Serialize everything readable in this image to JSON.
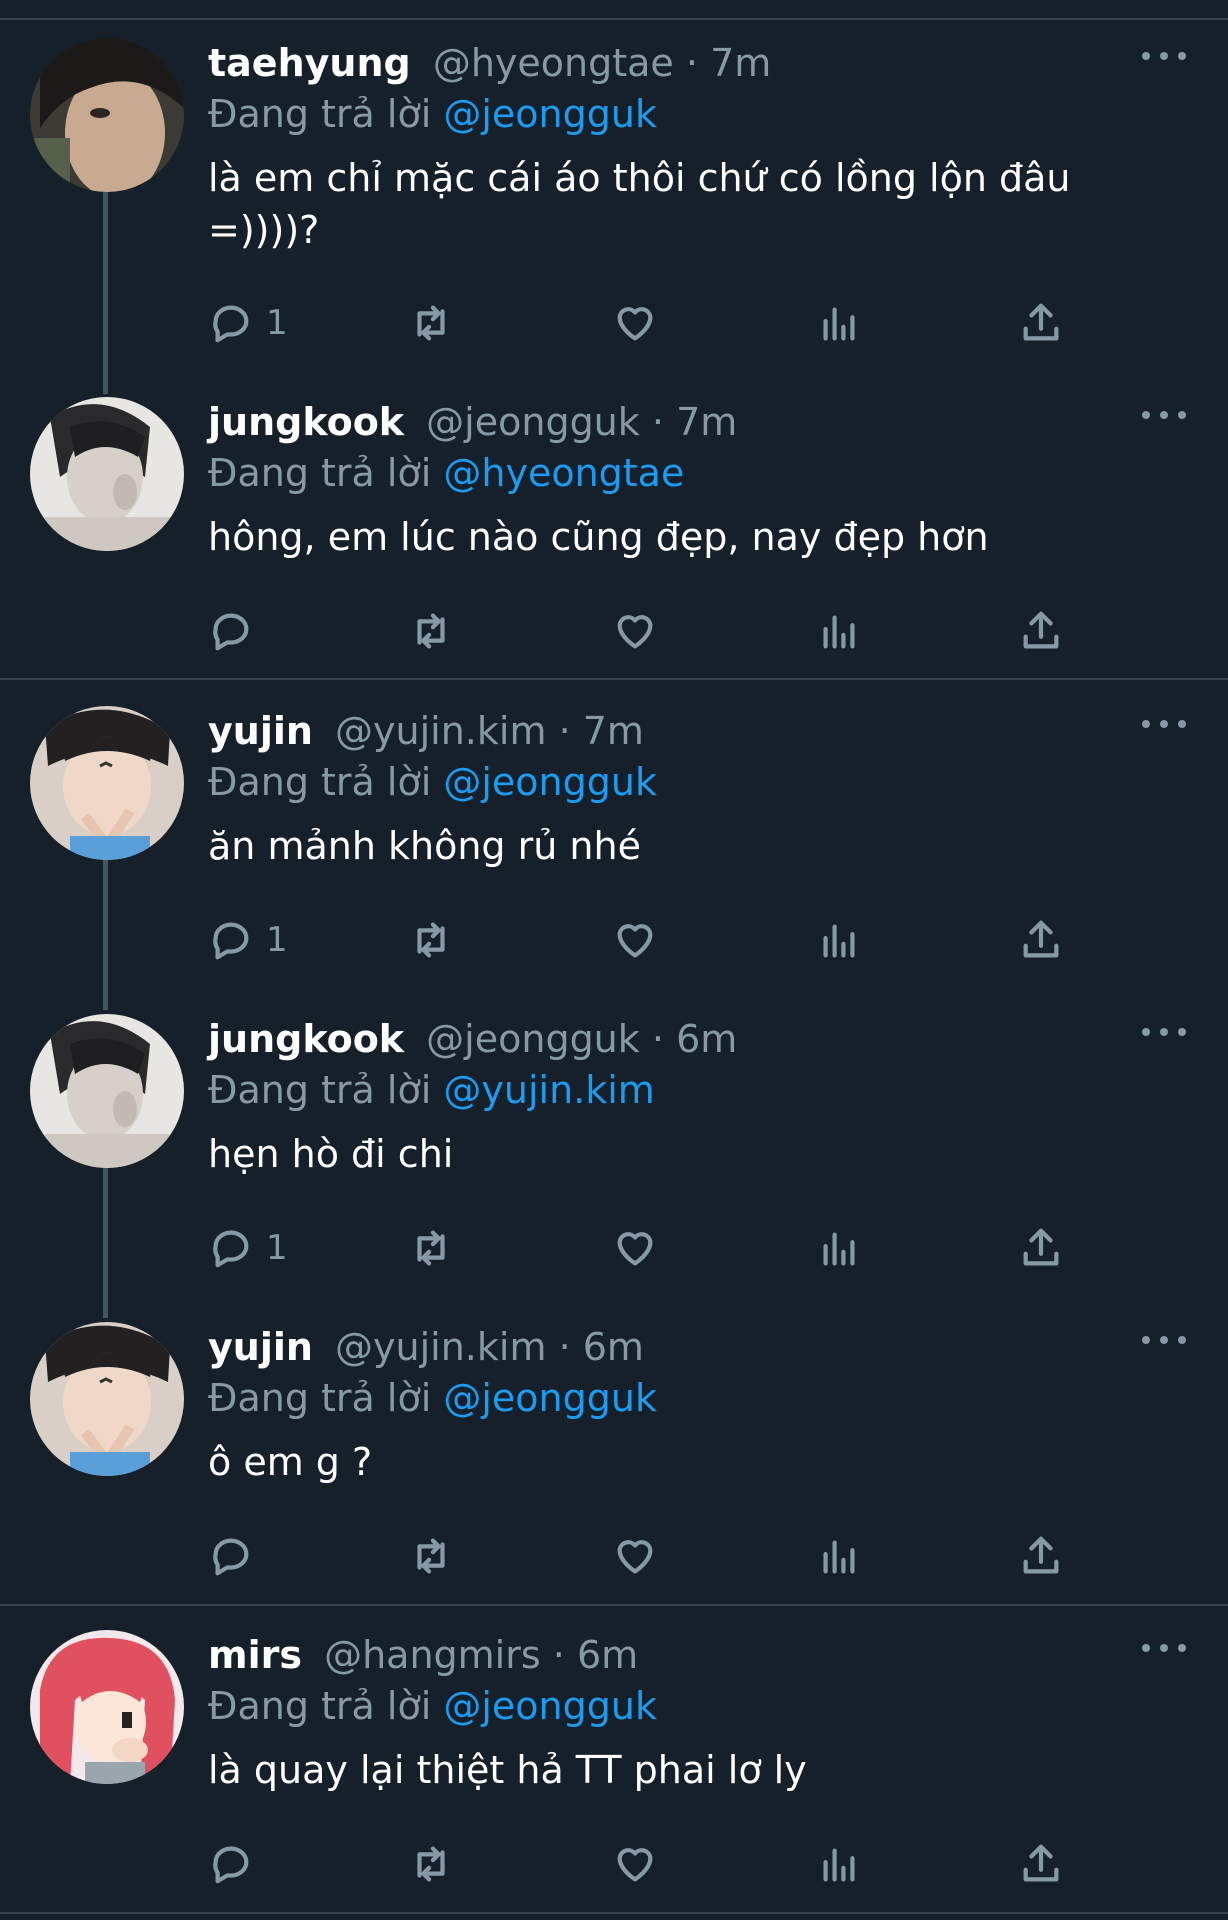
{
  "reply_prefix": "Đang trả lời",
  "tweets": [
    {
      "name": "taehyung",
      "handle": "@hyeongtae",
      "dot": "·",
      "time": "7m",
      "reply_to": "@jeongguk",
      "text_lines": [
        "là em chỉ mặc cái áo thôi chứ có lồng lộn đâu",
        "=))))?"
      ],
      "reply_count": "1"
    },
    {
      "name": "jungkook",
      "handle": "@jeongguk",
      "dot": "·",
      "time": "7m",
      "reply_to": "@hyeongtae",
      "text_lines": [
        "hông, em lúc nào cũng đẹp, nay đẹp hơn"
      ],
      "reply_count": ""
    },
    {
      "name": "yujin",
      "handle": "@yujin.kim",
      "dot": "·",
      "time": "7m",
      "reply_to": "@jeongguk",
      "text_lines": [
        "ăn mảnh không rủ nhé"
      ],
      "reply_count": "1"
    },
    {
      "name": "jungkook",
      "handle": "@jeongguk",
      "dot": "·",
      "time": "6m",
      "reply_to": "@yujin.kim",
      "text_lines": [
        "hẹn hò đi chi"
      ],
      "reply_count": "1"
    },
    {
      "name": "yujin",
      "handle": "@yujin.kim",
      "dot": "·",
      "time": "6m",
      "reply_to": "@jeongguk",
      "text_lines": [
        "ô em g ?"
      ],
      "reply_count": ""
    },
    {
      "name": "mirs",
      "handle": "@hangmirs",
      "dot": "·",
      "time": "6m",
      "reply_to": "@jeongguk",
      "text_lines": [
        "là quay lại thiệt hả TT phai lơ ly"
      ],
      "reply_count": ""
    }
  ],
  "icons": {
    "reply": "reply-icon",
    "retweet": "retweet-icon",
    "like": "heart-icon",
    "views": "analytics-icon",
    "share": "share-icon",
    "more": "more-icon"
  },
  "colors": {
    "background": "#15202b",
    "secondary_text": "#8899a6",
    "mention": "#1d9bf0",
    "divider": "#38444d"
  }
}
